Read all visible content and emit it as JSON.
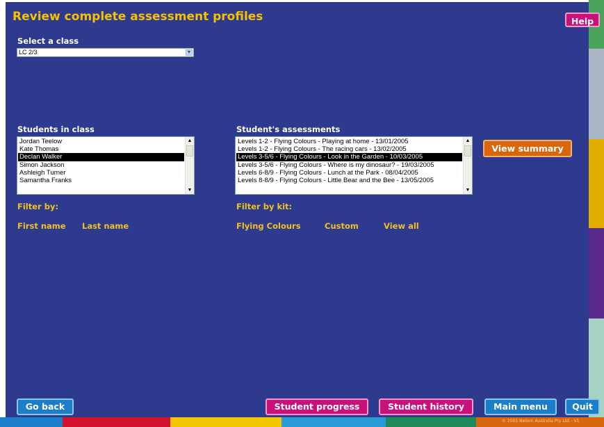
{
  "title": "Review complete assessment profiles",
  "help_label": "Help",
  "class_select": {
    "label": "Select a class",
    "selected": "LC 2/3"
  },
  "students": {
    "label": "Students in class",
    "items": [
      "Jordan Teelow",
      "Kate Thomas",
      "Declan Walker",
      "Simon Jackson",
      "Ashleigh Turner",
      "Samantha Franks"
    ],
    "selected_index": 2
  },
  "filter": {
    "label": "Filter by:",
    "first_name": "First name",
    "last_name": "Last name"
  },
  "assessments": {
    "label": "Student's assessments",
    "items": [
      "Levels 1-2 - Flying Colours - Playing at home - 13/01/2005",
      "Levels 1-2 - Flying Colours - The racing cars - 13/02/2005",
      "Levels 3-5/6 - Flying Colours - Look in the Garden - 10/03/2005",
      "Levels 3-5/6 - Flying Colours - Where is my dinosaur? - 19/03/2005",
      "Levels 6-8/9 - Flying Colours - Lunch at the Park - 08/04/2005",
      "Levels 8-8/9 - Flying Colours - Little Bear and the Bee - 13/05/2005"
    ],
    "selected_index": 2
  },
  "view_summary_label": "View summary",
  "kit_filter": {
    "label": "Filter by kit:",
    "options": [
      "Flying Colours",
      "Custom",
      "View all"
    ]
  },
  "buttons": {
    "go_back": "Go back",
    "student_progress": "Student progress",
    "student_history": "Student history",
    "main_menu": "Main menu",
    "quit": "Quit"
  },
  "copyright": "© 2005 Nelson Australia Pty Ltd – V1",
  "colors": {
    "panel": "#2d3a8e",
    "title": "#f5c200",
    "link_gold": "#f2c022",
    "button_blue": "#1c7ec8",
    "button_magenta": "#c8117a",
    "button_orange": "#d9660c"
  }
}
